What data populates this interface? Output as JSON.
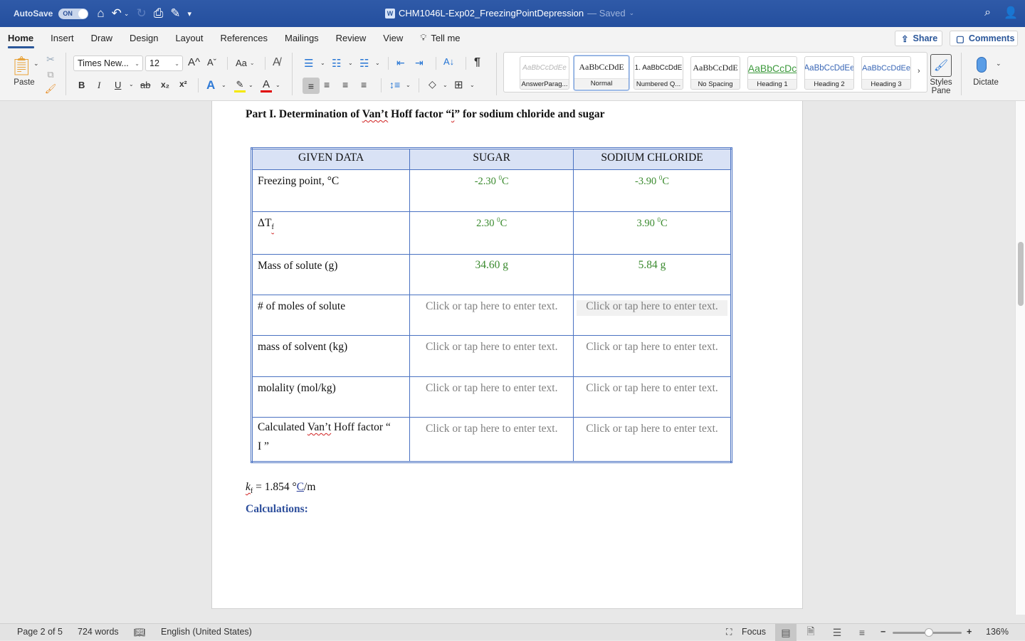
{
  "titlebar": {
    "autosave_label": "AutoSave",
    "autosave_state": "ON",
    "doc_title": "CHM1046L-Exp02_FreezingPointDepression",
    "saved_status": "— Saved",
    "icons": [
      "home-icon",
      "undo-icon",
      "redo-icon",
      "print-icon",
      "edit-icon",
      "customize-icon",
      "search-icon",
      "account-icon"
    ]
  },
  "tabs": [
    "Home",
    "Insert",
    "Draw",
    "Design",
    "Layout",
    "References",
    "Mailings",
    "Review",
    "View"
  ],
  "tell_me": "Tell me",
  "share_label": "Share",
  "comments_label": "Comments",
  "ribbon": {
    "paste_label": "Paste",
    "font_name": "Times New...",
    "font_size": "12",
    "grow_font": "A^",
    "shrink_font": "Aˇ",
    "change_case": "Aa",
    "bold": "B",
    "italic": "I",
    "underline": "U",
    "strikethrough": "ab",
    "subscript": "x₂",
    "superscript": "x²",
    "colors": {
      "highlight": "#f5e800",
      "font_color": "#e00000",
      "accent": "#2b579a"
    },
    "styles": [
      {
        "preview": "AaBbCcDdEe",
        "label": "AnswerParag..."
      },
      {
        "preview": "AaBbCcDdE",
        "label": "Normal",
        "selected": true
      },
      {
        "preview": "1. AaBbCcDdE",
        "label": "Numbered Q..."
      },
      {
        "preview": "AaBbCcDdE",
        "label": "No Spacing"
      },
      {
        "preview": "AaBbCcDc",
        "label": "Heading 1"
      },
      {
        "preview": "AaBbCcDdEe",
        "label": "Heading 2"
      },
      {
        "preview": "AaBbCcDdEe",
        "label": "Heading 3"
      }
    ],
    "styles_pane_label": "Styles Pane",
    "dictate_label": "Dictate"
  },
  "document": {
    "heading_pre": "Part I. Determination of ",
    "heading_vant": "Van’t",
    "heading_mid": " Hoff factor “",
    "heading_i": "i",
    "heading_post": "” for sodium chloride and sugar",
    "table": {
      "headers": [
        "GIVEN DATA",
        "SUGAR",
        "SODIUM CHLORIDE"
      ],
      "rows": [
        {
          "label": "Freezing point, °C",
          "sugar": "-2.30 ",
          "nacl": "-3.90 ",
          "unit_sup": "0",
          "unit": "C"
        },
        {
          "label_delta": "ΔT",
          "label_sub": "f",
          "sugar": "2.30 ",
          "nacl": "3.90 ",
          "unit_sup": "0",
          "unit": "C"
        },
        {
          "label": "Mass of solute (g)",
          "sugar": "34.60 g",
          "nacl": "5.84 g"
        },
        {
          "label": "# of moles of solute",
          "sugar": "Click or tap here to enter text.",
          "nacl": "Click or tap here to enter text."
        },
        {
          "label": "mass of solvent (kg)",
          "sugar": "Click or tap here to enter text.",
          "nacl": "Click or tap here to enter text."
        },
        {
          "label": "molality (mol/kg)",
          "sugar": "Click or tap here to enter text.",
          "nacl": "Click or tap here to enter text."
        },
        {
          "label_pre": "Calculated ",
          "label_vant": "Van’t",
          "label_post": " Hoff factor “",
          "label_line2": "I ”",
          "sugar": "Click or tap here to enter text.",
          "nacl": "Click or tap here to enter text."
        }
      ]
    },
    "kf_k": "k",
    "kf_sub": "f",
    "kf_value": " = 1.854 °",
    "kf_c": "C",
    "kf_unit": "/m",
    "calculations_label": "Calculations:"
  },
  "statusbar": {
    "page": "Page 2 of 5",
    "words": "724 words",
    "language": "English (United States)",
    "focus_label": "Focus",
    "zoom_level": "136%",
    "zoom_fraction": 0.53
  }
}
